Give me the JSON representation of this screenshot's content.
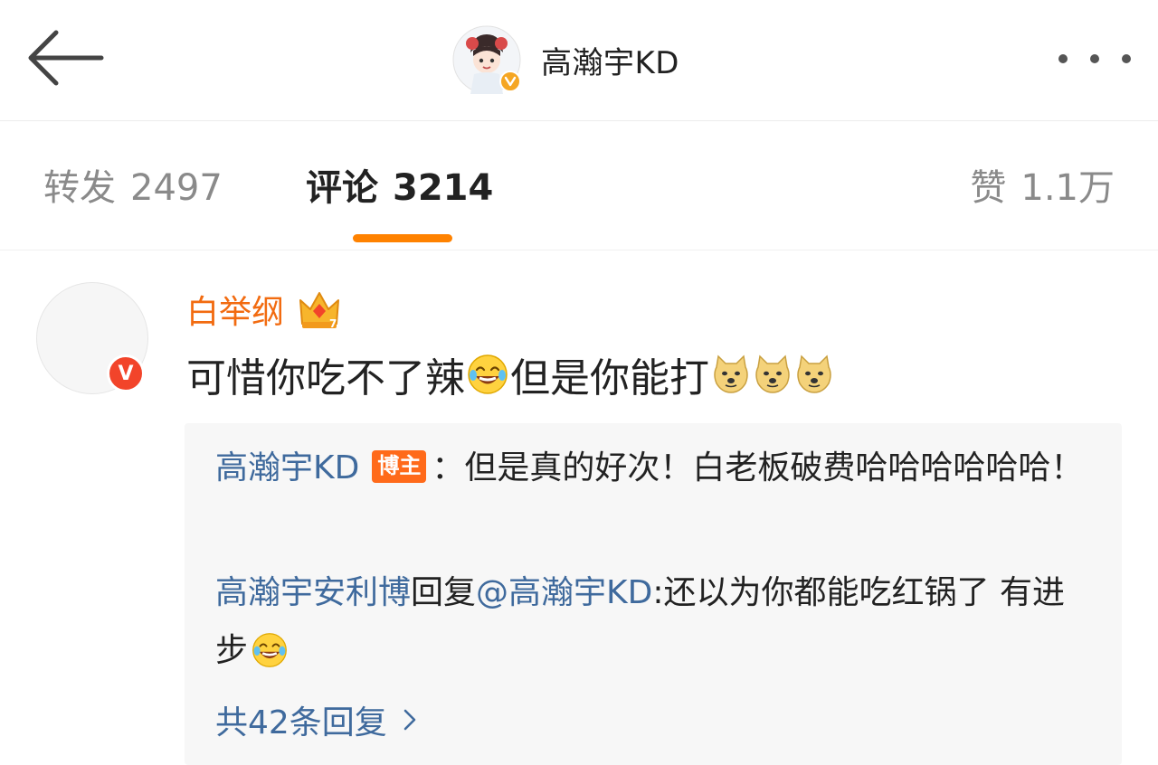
{
  "header": {
    "title": "高瀚宇KD",
    "back_icon": "back-arrow-icon",
    "more_icon": "more-dots-icon",
    "verified_color": "#f5a623"
  },
  "tabs": {
    "repost_label": "转发",
    "repost_count": "2497",
    "comment_label": "评论",
    "comment_count": "3214",
    "like_label": "赞",
    "like_count": "1.1万",
    "active": "comment",
    "indicator_color": "#ff8200"
  },
  "comment": {
    "user": "白举纲",
    "verified_badge": "V",
    "text_part1": "可惜你吃不了辣",
    "text_part2": "但是你能打",
    "emoji_laugh": "laugh-cry-emoji",
    "emoji_doge": "doge-emoji",
    "name_color": "#f26b10"
  },
  "replies": {
    "reply1_user": "高瀚宇KD",
    "reply1_badge": "博主",
    "reply1_text": "：但是真的好次！白老板破费哈哈哈哈哈哈！",
    "reply2_user": "高瀚宇安利博",
    "reply2_mid": "回复",
    "reply2_mention": "@高瀚宇KD",
    "reply2_text": ":还以为你都能吃红锅了 有进步",
    "more_label": "共42条回复",
    "link_color": "#3f6a9d"
  }
}
